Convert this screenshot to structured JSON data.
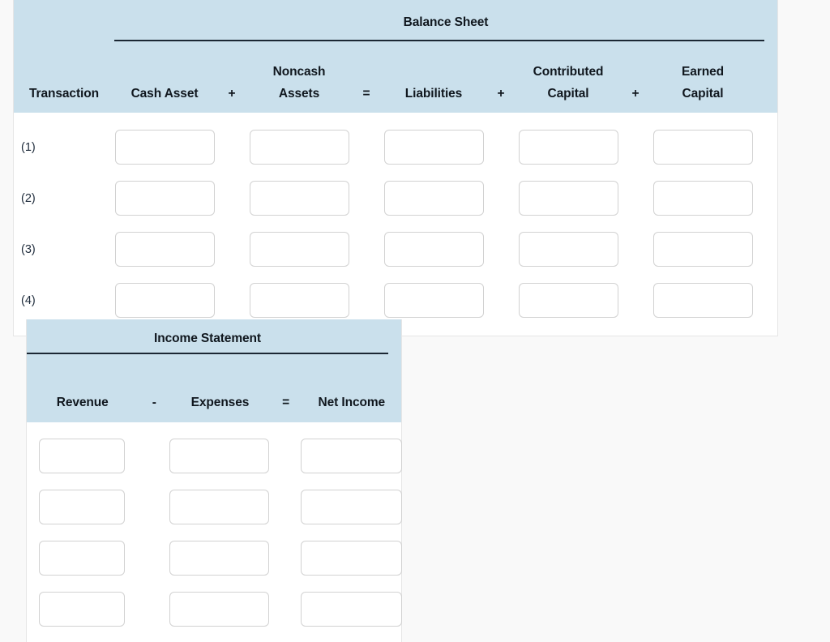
{
  "page": {
    "background_color": "#f9f9f9",
    "header_fill_color": "#cae0ec",
    "rule_color": "#1b2733",
    "input_border_color": "#d2d2d2"
  },
  "balance_sheet": {
    "title": "Balance Sheet",
    "transaction_header": "Transaction",
    "columns": [
      {
        "label": "Cash Asset",
        "operator_after": "+"
      },
      {
        "label": "Noncash Assets",
        "line1": "Noncash",
        "line2": "Assets",
        "operator_after": "="
      },
      {
        "label": "Liabilities",
        "operator_after": "+"
      },
      {
        "label": "Contributed Capital",
        "line1": "Contributed",
        "line2": "Capital",
        "operator_after": "+"
      },
      {
        "label": "Earned Capital",
        "line1": "Earned",
        "line2": "Capital",
        "operator_after": ""
      }
    ],
    "operators": [
      "+",
      "=",
      "+",
      "+"
    ],
    "rows": [
      {
        "label": "(1)",
        "cash_asset": "",
        "noncash_assets": "",
        "liabilities": "",
        "contributed_capital": "",
        "earned_capital": ""
      },
      {
        "label": "(2)",
        "cash_asset": "",
        "noncash_assets": "",
        "liabilities": "",
        "contributed_capital": "",
        "earned_capital": ""
      },
      {
        "label": "(3)",
        "cash_asset": "",
        "noncash_assets": "",
        "liabilities": "",
        "contributed_capital": "",
        "earned_capital": ""
      },
      {
        "label": "(4)",
        "cash_asset": "",
        "noncash_assets": "",
        "liabilities": "",
        "contributed_capital": "",
        "earned_capital": ""
      }
    ]
  },
  "income_statement": {
    "title": "Income Statement",
    "columns": [
      {
        "label": "Revenue",
        "operator_after": "-"
      },
      {
        "label": "Expenses",
        "operator_after": "="
      },
      {
        "label": "Net Income",
        "operator_after": ""
      }
    ],
    "operators": [
      "-",
      "="
    ],
    "rows": [
      {
        "revenue": "",
        "expenses": "",
        "net_income": ""
      },
      {
        "revenue": "",
        "expenses": "",
        "net_income": ""
      },
      {
        "revenue": "",
        "expenses": "",
        "net_income": ""
      },
      {
        "revenue": "",
        "expenses": "",
        "net_income": ""
      }
    ]
  }
}
